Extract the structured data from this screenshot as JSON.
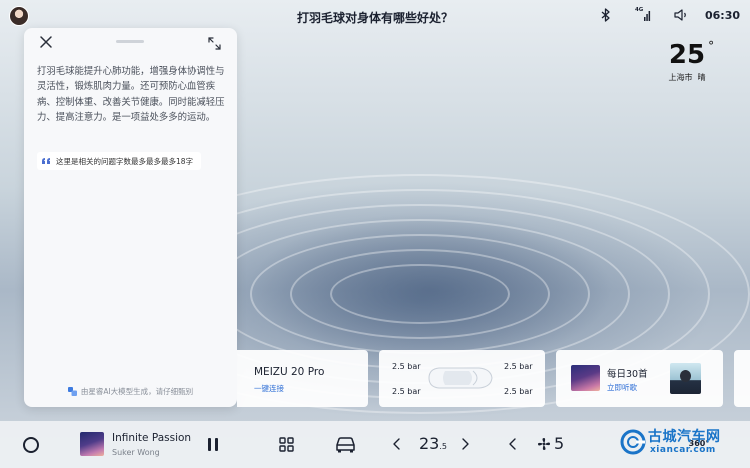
{
  "status_bar": {
    "question": "打羽毛球对身体有哪些好处？",
    "signal_label": "4G",
    "time": "06:30",
    "icons": [
      "avatar",
      "bluetooth-icon",
      "signal-icon",
      "volume-icon"
    ]
  },
  "weather": {
    "temperature": "25",
    "unit": "°",
    "location": "上海市",
    "condition": "晴"
  },
  "ai_panel": {
    "answer": "打羽毛球能提升心肺功能，增强身体协调性与灵活性，锻炼肌肉力量。还可预防心血管疾病、控制体重、改善关节健康。同时能减轻压力、提高注意力。是一项益处多多的运动。",
    "related_question": "这里是相关的问题字数最多最多最多18字",
    "footer": "由星睿AI大模型生成，请仔细甄别"
  },
  "phone_card": {
    "device_name": "MEIZU 20 Pro",
    "action": "一键连接"
  },
  "tire_card": {
    "front_left": "2.5 bar",
    "front_right": "2.5 bar",
    "rear_left": "2.5 bar",
    "rear_right": "2.5 bar"
  },
  "music_card": {
    "title": "每日30首",
    "action": "立即听歌"
  },
  "dock": {
    "song_title": "Infinite Passion",
    "artist": "Suker Wong",
    "temperature_main": "23",
    "temperature_decimal": ".5",
    "fan_speed": "5",
    "view_label": "360°"
  },
  "watermark": {
    "name": "古城汽车网",
    "url": "xiancar.com"
  },
  "colors": {
    "accent_blue": "#2f6fd6",
    "panel_bg": "#f7f8fa",
    "watermark_blue": "#1a74c8"
  }
}
